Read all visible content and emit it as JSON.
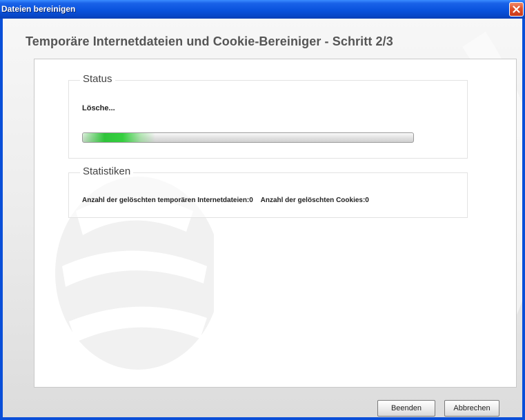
{
  "window": {
    "title": "Dateien bereinigen",
    "close_icon": "close-icon"
  },
  "wizard": {
    "heading": "Temporäre Internetdateien und Cookie-Bereiniger - Schritt 2/3"
  },
  "status": {
    "legend": "Status",
    "message": "Lösche...",
    "progress_fraction": 0.22
  },
  "statistics": {
    "legend": "Statistiken",
    "temp_files_label": "Anzahl der gelöschten temporären Internetdateien:0",
    "cookies_label": "Anzahl der gelöschten Cookies:0"
  },
  "buttons": {
    "finish": "Beenden",
    "cancel": "Abbrechen"
  },
  "colors": {
    "titlebar": "#0a53dd",
    "progress": "#35cf3f",
    "close": "#e0502a"
  }
}
